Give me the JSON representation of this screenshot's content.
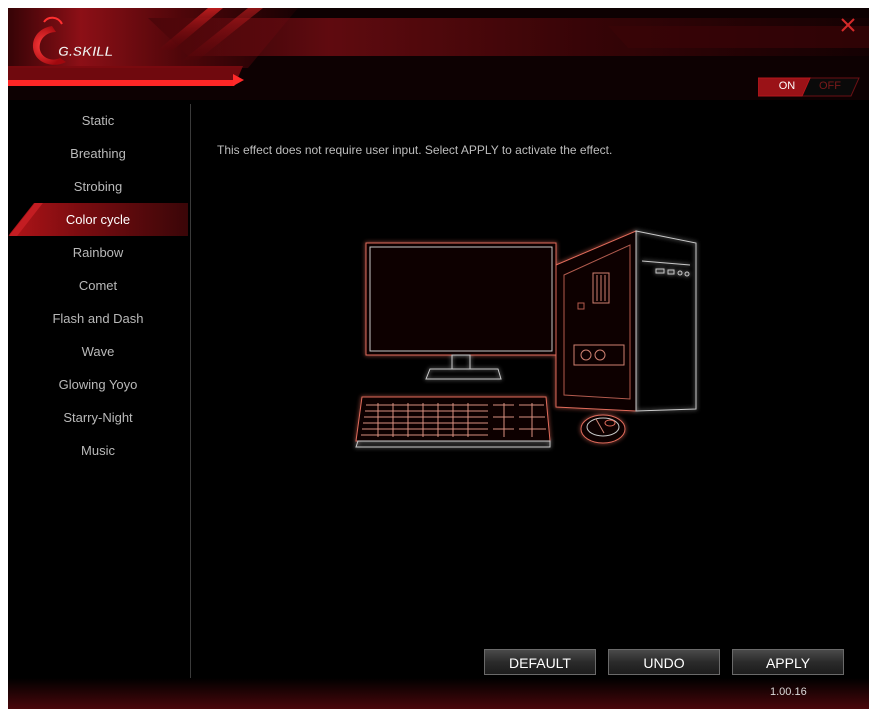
{
  "app": {
    "brand": "G.SKILL",
    "close_icon": "close-icon",
    "accent_color": "#c31d22"
  },
  "power_toggle": {
    "on_label": "ON",
    "off_label": "OFF",
    "state": "ON"
  },
  "sidebar": {
    "items": [
      {
        "label": "Static",
        "active": false
      },
      {
        "label": "Breathing",
        "active": false
      },
      {
        "label": "Strobing",
        "active": false
      },
      {
        "label": "Color cycle",
        "active": true
      },
      {
        "label": "Rainbow",
        "active": false
      },
      {
        "label": "Comet",
        "active": false
      },
      {
        "label": "Flash and Dash",
        "active": false
      },
      {
        "label": "Wave",
        "active": false
      },
      {
        "label": "Glowing Yoyo",
        "active": false
      },
      {
        "label": "Starry-Night",
        "active": false
      },
      {
        "label": "Music",
        "active": false
      }
    ]
  },
  "main": {
    "instruction": "This effect does not require user input. Select APPLY to activate the effect.",
    "illustration_icon": "pc-setup-illustration"
  },
  "buttons": {
    "default": "DEFAULT",
    "undo": "UNDO",
    "apply": "APPLY"
  },
  "footer": {
    "version": "1.00.16"
  }
}
